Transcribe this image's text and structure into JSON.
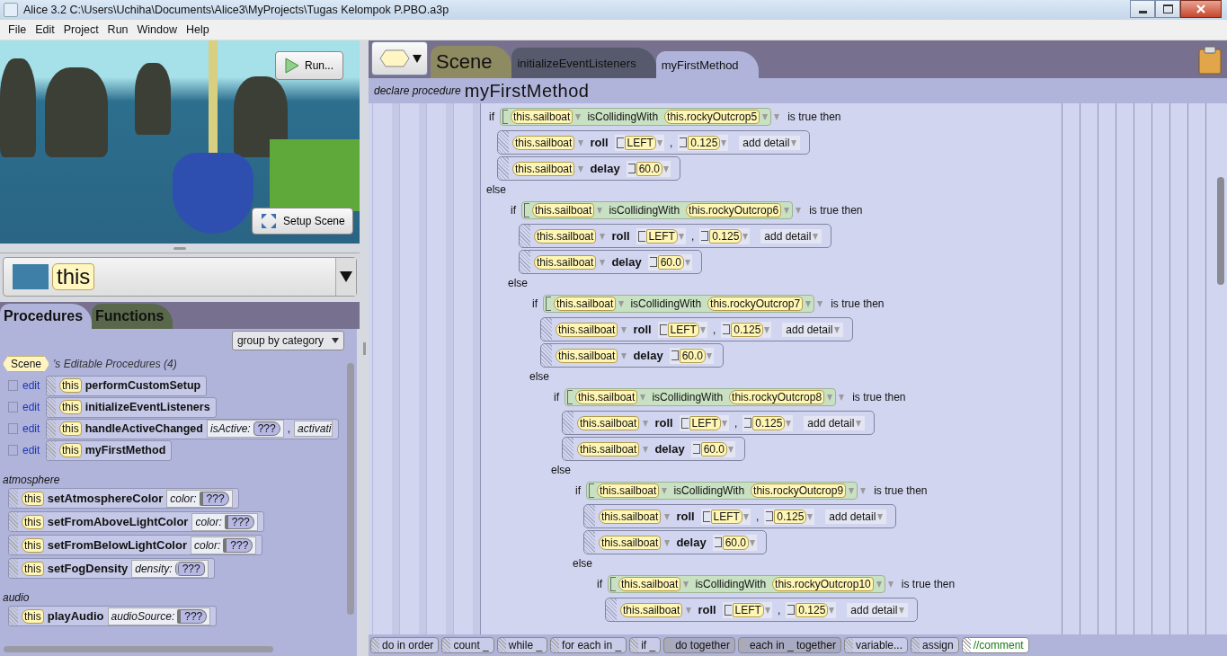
{
  "window": {
    "title": "Alice  3.2 C:\\Users\\Uchiha\\Documents\\Alice3\\MyProjects\\Tugas Kelompok P.PBO.a3p"
  },
  "menu": [
    "File",
    "Edit",
    "Project",
    "Run",
    "Window",
    "Help"
  ],
  "scene_view": {
    "run_button": "Run...",
    "setup_button": "Setup Scene"
  },
  "selector": {
    "value": "this"
  },
  "panel_tabs": [
    {
      "label": "Procedures",
      "selected": true
    },
    {
      "label": "Functions",
      "selected": false
    }
  ],
  "group_by": "group by category",
  "editable": {
    "owner": "Scene",
    "title": "'s Editable Procedures (4)",
    "items": [
      {
        "edit": "edit",
        "target": "this",
        "name": "performCustomSetup"
      },
      {
        "edit": "edit",
        "target": "this",
        "name": "initializeEventListeners"
      },
      {
        "edit": "edit",
        "target": "this",
        "name": "handleActiveChanged",
        "params": [
          {
            "kind": "boolean",
            "label": "isActive:",
            "value": "???"
          },
          {
            "kind": "comma",
            "label": ","
          },
          {
            "kind": "plain",
            "label": "activati"
          }
        ]
      },
      {
        "edit": "edit",
        "target": "this",
        "name": "myFirstMethod"
      }
    ]
  },
  "categories": [
    {
      "name": "atmosphere",
      "items": [
        {
          "target": "this",
          "name": "setAtmosphereColor",
          "params": [
            {
              "kind": "color",
              "label": "color:",
              "value": "???"
            }
          ]
        },
        {
          "target": "this",
          "name": "setFromAboveLightColor",
          "params": [
            {
              "kind": "color",
              "label": "color:",
              "value": "???"
            }
          ]
        },
        {
          "target": "this",
          "name": "setFromBelowLightColor",
          "params": [
            {
              "kind": "color",
              "label": "color:",
              "value": "???"
            }
          ]
        },
        {
          "target": "this",
          "name": "setFogDensity",
          "params": [
            {
              "kind": "number",
              "label": "density:",
              "value": "???"
            }
          ]
        }
      ]
    },
    {
      "name": "audio",
      "items": [
        {
          "target": "this",
          "name": "playAudio",
          "params": [
            {
              "kind": "color",
              "label": "audioSource:",
              "value": "???"
            }
          ]
        }
      ]
    }
  ],
  "editor_tabs": [
    {
      "label": "Scene",
      "kind": "class",
      "selected": false
    },
    {
      "label": "initializeEventListeners",
      "kind": "method",
      "selected": false
    },
    {
      "label": "myFirstMethod",
      "kind": "method",
      "selected": true
    }
  ],
  "declare": {
    "prefix": "declare procedure",
    "name": "myFirstMethod"
  },
  "code": {
    "blocks": [
      {
        "keyword": "if",
        "subject": "this.sailboat",
        "function": "isCollidingWith",
        "argument": "this.rockyOutcrop5",
        "suffix": "is true then",
        "body": [
          {
            "kind": "roll",
            "subject": "this.sailboat",
            "verb": "roll",
            "direction": "LEFT",
            "comma": ",",
            "amount": "0.125",
            "detail": "add detail"
          },
          {
            "kind": "delay",
            "subject": "this.sailboat",
            "verb": "delay",
            "amount": "60.0"
          }
        ],
        "else": "else",
        "children": [
          {
            "keyword": "if",
            "subject": "this.sailboat",
            "function": "isCollidingWith",
            "argument": "this.rockyOutcrop6",
            "suffix": "is true then",
            "body": [
              {
                "kind": "roll",
                "subject": "this.sailboat",
                "verb": "roll",
                "direction": "LEFT",
                "comma": ",",
                "amount": "0.125",
                "detail": "add detail"
              },
              {
                "kind": "delay",
                "subject": "this.sailboat",
                "verb": "delay",
                "amount": "60.0"
              }
            ],
            "else": "else",
            "children": [
              {
                "keyword": "if",
                "subject": "this.sailboat",
                "function": "isCollidingWith",
                "argument": "this.rockyOutcrop7",
                "suffix": "is true then",
                "body": [
                  {
                    "kind": "roll",
                    "subject": "this.sailboat",
                    "verb": "roll",
                    "direction": "LEFT",
                    "comma": ",",
                    "amount": "0.125",
                    "detail": "add detail"
                  },
                  {
                    "kind": "delay",
                    "subject": "this.sailboat",
                    "verb": "delay",
                    "amount": "60.0"
                  }
                ],
                "else": "else",
                "children": [
                  {
                    "keyword": "if",
                    "subject": "this.sailboat",
                    "function": "isCollidingWith",
                    "argument": "this.rockyOutcrop8",
                    "suffix": "is true then",
                    "body": [
                      {
                        "kind": "roll",
                        "subject": "this.sailboat",
                        "verb": "roll",
                        "direction": "LEFT",
                        "comma": ",",
                        "amount": "0.125",
                        "detail": "add detail"
                      },
                      {
                        "kind": "delay",
                        "subject": "this.sailboat",
                        "verb": "delay",
                        "amount": "60.0"
                      }
                    ],
                    "else": "else",
                    "children": [
                      {
                        "keyword": "if",
                        "subject": "this.sailboat",
                        "function": "isCollidingWith",
                        "argument": "this.rockyOutcrop9",
                        "suffix": "is true then",
                        "body": [
                          {
                            "kind": "roll",
                            "subject": "this.sailboat",
                            "verb": "roll",
                            "direction": "LEFT",
                            "comma": ",",
                            "amount": "0.125",
                            "detail": "add detail"
                          },
                          {
                            "kind": "delay",
                            "subject": "this.sailboat",
                            "verb": "delay",
                            "amount": "60.0"
                          }
                        ],
                        "else": "else",
                        "children": [
                          {
                            "keyword": "if",
                            "subject": "this.sailboat",
                            "function": "isCollidingWith",
                            "argument": "this.rockyOutcrop10",
                            "suffix": "is true then",
                            "body": [
                              {
                                "kind": "roll",
                                "subject": "this.sailboat",
                                "verb": "roll",
                                "direction": "LEFT",
                                "comma": ",",
                                "amount": "0.125",
                                "detail": "add detail"
                              }
                            ]
                          }
                        ]
                      }
                    ]
                  }
                ]
              }
            ]
          }
        ]
      }
    ]
  },
  "palette": [
    {
      "label": "do in order",
      "kind": "plain"
    },
    {
      "label": "count _",
      "kind": "plain"
    },
    {
      "label": "while _",
      "kind": "plain"
    },
    {
      "label": "for each in _",
      "kind": "plain"
    },
    {
      "label": "if _",
      "kind": "plain"
    },
    {
      "label": "do together",
      "kind": "dark"
    },
    {
      "label": "each in _ together",
      "kind": "dark"
    },
    {
      "label": "variable...",
      "kind": "plain"
    },
    {
      "label": "assign",
      "kind": "plain"
    },
    {
      "label": "//comment",
      "kind": "comment"
    }
  ]
}
